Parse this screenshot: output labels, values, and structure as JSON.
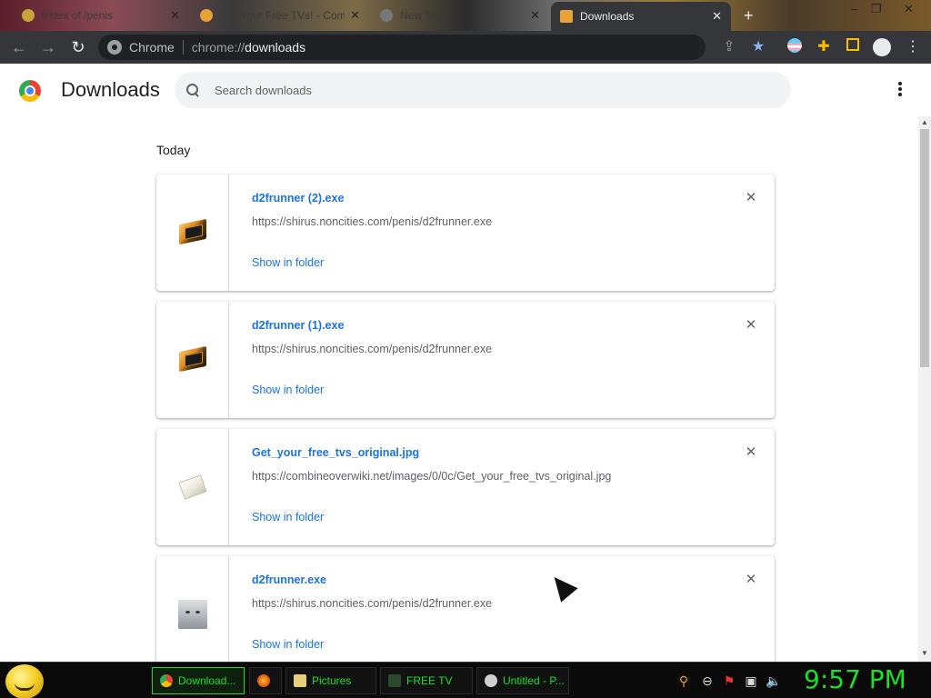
{
  "browser": {
    "tabs": [
      {
        "title": "Index of /penis",
        "active": false
      },
      {
        "title": "Get Your Free TVs! - Com",
        "active": false
      },
      {
        "title": "New Tab",
        "active": false
      },
      {
        "title": "Downloads",
        "active": true
      }
    ],
    "new_tab_glyph": "+",
    "window_controls": [
      "–",
      "❐",
      "✕"
    ],
    "omnibox": {
      "scheme_label": "Chrome",
      "url_prefix": "chrome://",
      "url_host": "downloads"
    }
  },
  "page": {
    "title": "Downloads",
    "search_placeholder": "Search downloads",
    "date_heading": "Today",
    "items": [
      {
        "name": "d2frunner (2).exe",
        "url": "https://shirus.noncities.com/penis/d2frunner.exe",
        "action": "Show in folder",
        "icon": "exe-file-icon"
      },
      {
        "name": "d2frunner (1).exe",
        "url": "https://shirus.noncities.com/penis/d2frunner.exe",
        "action": "Show in folder",
        "icon": "exe-file-icon"
      },
      {
        "name": "Get_your_free_tvs_original.jpg",
        "url": "https://combineoverwiki.net/images/0/0c/Get_your_free_tvs_original.jpg",
        "action": "Show in folder",
        "icon": "image-file-icon"
      },
      {
        "name": "d2frunner.exe",
        "url": "https://shirus.noncities.com/penis/d2frunner.exe",
        "action": "Show in folder",
        "icon": "cat-thumbnail-icon"
      }
    ]
  },
  "taskbar": {
    "tasks": [
      {
        "label": "Download...",
        "active": true
      },
      {
        "label": "",
        "active": false
      },
      {
        "label": "Pictures",
        "active": false
      },
      {
        "label": "FREE TV",
        "active": false
      },
      {
        "label": "Untitled - P...",
        "active": false
      }
    ],
    "clock": "9:57 PM"
  },
  "colors": {
    "link_blue": "#1a73e8",
    "taskbar_green": "#19e02a",
    "toolbar_dark": "#35363a"
  }
}
